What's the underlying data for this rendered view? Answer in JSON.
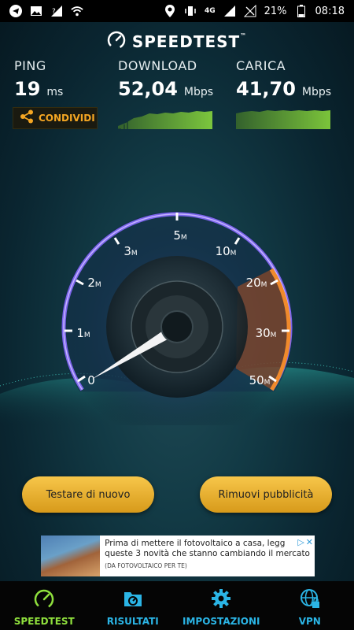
{
  "status_bar": {
    "network": "4G",
    "battery": "21%",
    "time": "08:18"
  },
  "header": {
    "title": "SPEEDTEST",
    "tm": "™"
  },
  "stats": {
    "ping": {
      "label": "PING",
      "value": "19",
      "unit": "ms"
    },
    "download": {
      "label": "DOWNLOAD",
      "value": "52,04",
      "unit": "Mbps"
    },
    "upload": {
      "label": "CARICA",
      "value": "41,70",
      "unit": "Mbps"
    }
  },
  "share_button": {
    "label": "CONDIVIDI"
  },
  "gauge": {
    "ticks": [
      "0",
      "1",
      "2",
      "3",
      "5",
      "10",
      "20",
      "30",
      "50"
    ],
    "tick_unit": "M",
    "value_mbps": 0
  },
  "buttons": {
    "retest": "Testare di nuovo",
    "remove_ads": "Rimuovi pubblicità"
  },
  "ad": {
    "line1": "Prima di mettere il fotovoltaico a casa, legg",
    "line2": "queste 3 novità che stanno cambiando il mercato",
    "source": "(DA FOTOVOLTAICO PER TE)"
  },
  "nav": [
    {
      "label": "SPEEDTEST",
      "icon": "gauge-icon",
      "active": true
    },
    {
      "label": "RISULTATI",
      "icon": "results-icon",
      "active": false
    },
    {
      "label": "IMPOSTAZIONI",
      "icon": "gear-icon",
      "active": false
    },
    {
      "label": "VPN",
      "icon": "globe-lock-icon",
      "active": false
    }
  ],
  "colors": {
    "accent_green": "#8fe03d",
    "accent_blue": "#2bb5e6",
    "button_yellow": "#f4b730",
    "gauge_purple": "#8a6cff",
    "gauge_orange": "#f08a2c"
  }
}
